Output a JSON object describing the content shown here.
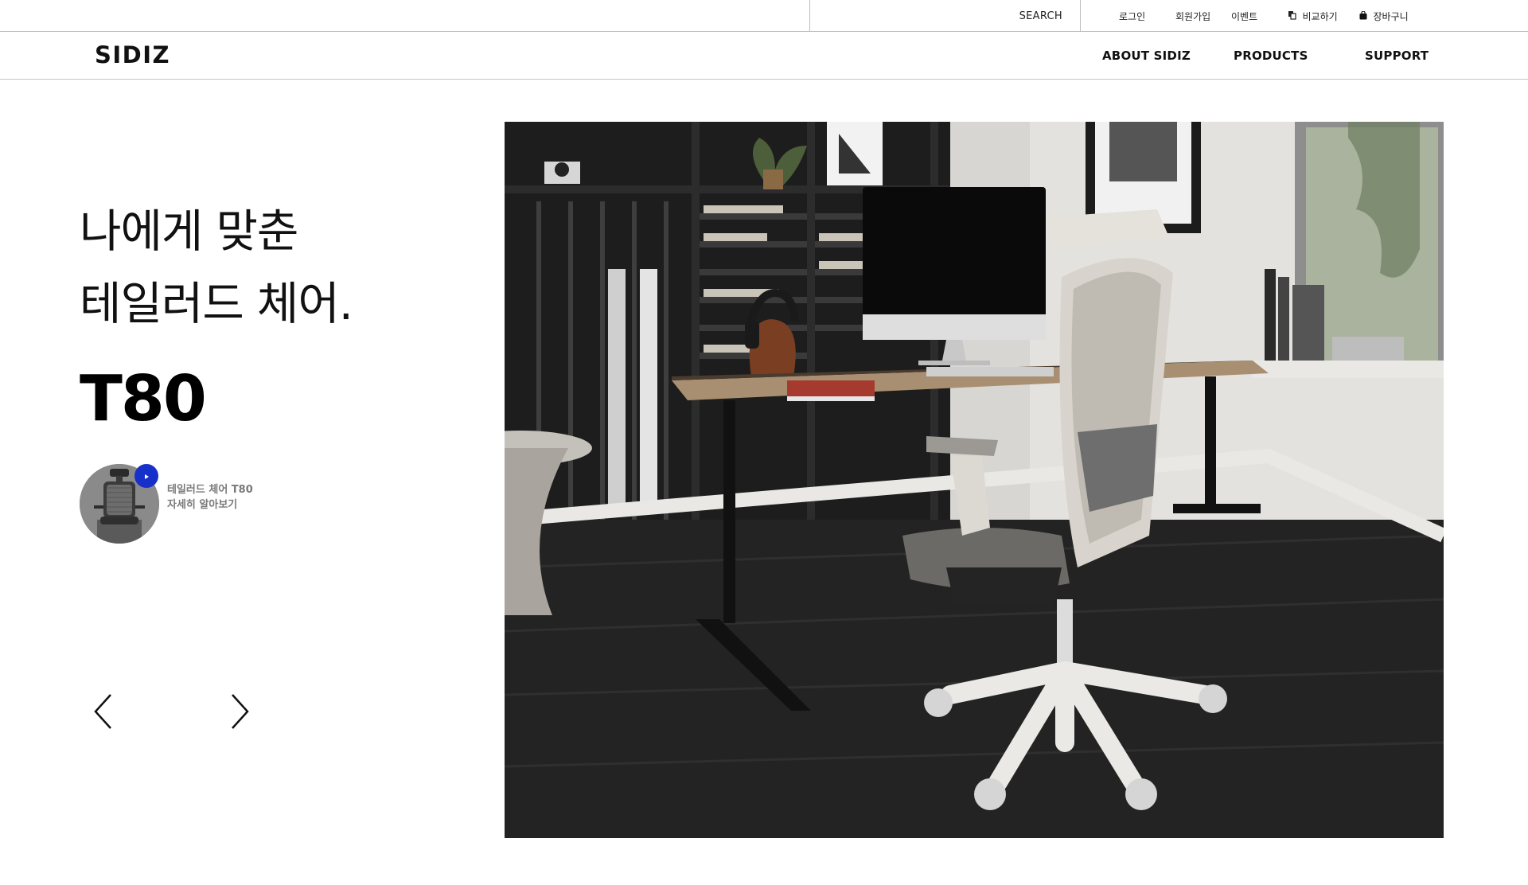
{
  "utility_bar": {
    "search_label": "SEARCH",
    "login": "로그인",
    "signup": "회원가입",
    "event": "이벤트",
    "compare": "비교하기",
    "cart": "장바구니"
  },
  "brand": {
    "logo": "SIDIZ"
  },
  "nav": {
    "about": "ABOUT SIDIZ",
    "products": "PRODUCTS",
    "support": "SUPPORT"
  },
  "hero": {
    "headline_line1": "나에게 맞춘",
    "headline_line2": "테일러드 체어.",
    "model": "T80",
    "thumb_line1": "테일러드 체어 T80",
    "thumb_line2": "자세히 알아보기",
    "accent_color": "#1730c9"
  },
  "icons": {
    "compare": "compare-icon",
    "cart": "shopping-bag-icon",
    "play": "play-icon",
    "prev": "chevron-left-icon",
    "next": "chevron-right-icon"
  }
}
